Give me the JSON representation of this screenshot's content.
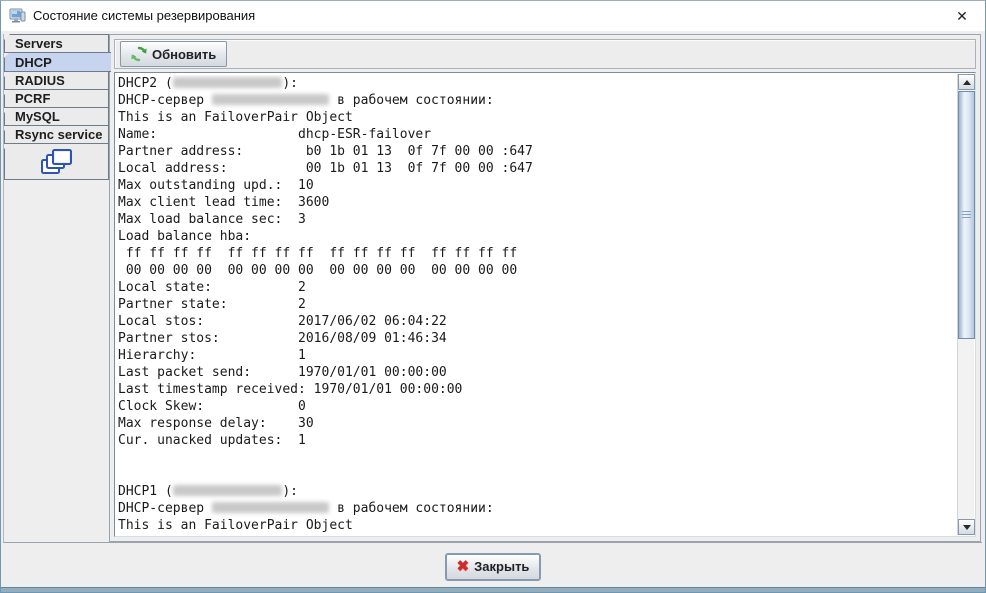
{
  "window": {
    "title": "Состояние системы резервирования",
    "close_glyph": "✕"
  },
  "tabs": [
    {
      "id": "servers",
      "label": "Servers",
      "selected": false
    },
    {
      "id": "dhcp",
      "label": "DHCP",
      "selected": true
    },
    {
      "id": "radius",
      "label": "RADIUS",
      "selected": false
    },
    {
      "id": "pcrf",
      "label": "PCRF",
      "selected": false
    },
    {
      "id": "mysql",
      "label": "MySQL",
      "selected": false
    },
    {
      "id": "rsync-service",
      "label": "Rsync service",
      "selected": false
    }
  ],
  "icon_tab": {
    "icon": "cascade-windows-icon"
  },
  "toolbar": {
    "refresh_label": "Обновить",
    "refresh_icon": "refresh-icon"
  },
  "console": {
    "lines": [
      [
        {
          "text": "DHCP2 ("
        },
        {
          "redacted_chars": 14
        },
        {
          "text": "):"
        }
      ],
      [
        {
          "text": "DHCP-сервер "
        },
        {
          "redacted_chars": 15
        },
        {
          "text": " в рабочем состоянии:"
        }
      ],
      [
        {
          "text": "This is an FailoverPair Object"
        }
      ],
      [
        {
          "text": "Name:                  dhcp-ESR-failover"
        }
      ],
      [
        {
          "text": "Partner address:        b0 1b 01 13  0f 7f 00 00 :647"
        }
      ],
      [
        {
          "text": "Local address:          00 1b 01 13  0f 7f 00 00 :647"
        }
      ],
      [
        {
          "text": "Max outstanding upd.:  10"
        }
      ],
      [
        {
          "text": "Max client lead time:  3600"
        }
      ],
      [
        {
          "text": "Max load balance sec:  3"
        }
      ],
      [
        {
          "text": "Load balance hba:"
        }
      ],
      [
        {
          "text": " ff ff ff ff  ff ff ff ff  ff ff ff ff  ff ff ff ff"
        }
      ],
      [
        {
          "text": " 00 00 00 00  00 00 00 00  00 00 00 00  00 00 00 00"
        }
      ],
      [
        {
          "text": "Local state:           2"
        }
      ],
      [
        {
          "text": "Partner state:         2"
        }
      ],
      [
        {
          "text": "Local stos:            2017/06/02 06:04:22"
        }
      ],
      [
        {
          "text": "Partner stos:          2016/08/09 01:46:34"
        }
      ],
      [
        {
          "text": "Hierarchy:             1"
        }
      ],
      [
        {
          "text": "Last packet send:      1970/01/01 00:00:00"
        }
      ],
      [
        {
          "text": "Last timestamp received: 1970/01/01 00:00:00"
        }
      ],
      [
        {
          "text": "Clock Skew:            0"
        }
      ],
      [
        {
          "text": "Max response delay:    30"
        }
      ],
      [
        {
          "text": "Cur. unacked updates:  1"
        }
      ],
      [
        {
          "text": ""
        }
      ],
      [
        {
          "text": ""
        }
      ],
      [
        {
          "text": "DHCP1 ("
        },
        {
          "redacted_chars": 14
        },
        {
          "text": "):"
        }
      ],
      [
        {
          "text": "DHCP-сервер "
        },
        {
          "redacted_chars": 15
        },
        {
          "text": " в рабочем состоянии:"
        }
      ],
      [
        {
          "text": "This is an FailoverPair Object"
        }
      ]
    ]
  },
  "footer": {
    "close_label": "Закрыть",
    "close_icon_glyph": "✖"
  },
  "colors": {
    "selected_tab": "#c7d4ef",
    "refresh_green": "#3fa13f",
    "close_red": "#cf2b2b",
    "window_border": "#6f97b1"
  }
}
